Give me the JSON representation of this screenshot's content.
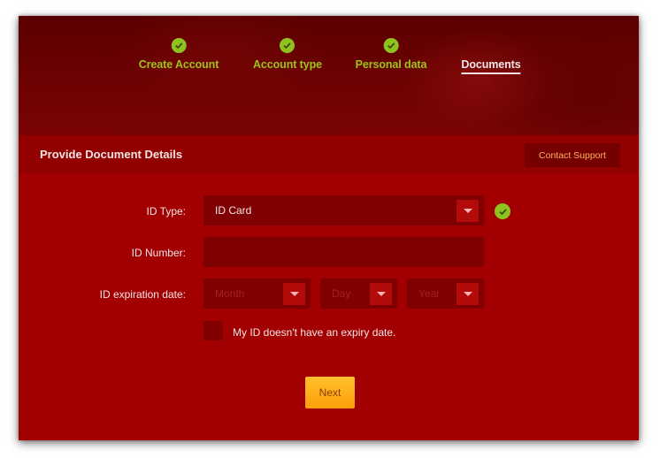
{
  "colors": {
    "accent_green": "#8dc21f",
    "primary_red": "#a20000",
    "button_orange": "#ffb01a",
    "contact_text": "#f6b75f"
  },
  "steps": [
    {
      "label": "Create Account",
      "status": "completed",
      "icon": "check-circle-icon"
    },
    {
      "label": "Account type",
      "status": "completed",
      "icon": "check-circle-icon"
    },
    {
      "label": "Personal data",
      "status": "completed",
      "icon": "check-circle-icon"
    },
    {
      "label": "Documents",
      "status": "active"
    }
  ],
  "section": {
    "title": "Provide Document Details",
    "contact_label": "Contact Support"
  },
  "form": {
    "id_type": {
      "label": "ID Type:",
      "value": "ID Card",
      "valid": true,
      "icon": "chevron-down-icon"
    },
    "id_number": {
      "label": "ID Number:",
      "value": "",
      "placeholder": ""
    },
    "expiration": {
      "label": "ID expiration date:",
      "month_placeholder": "Month",
      "day_placeholder": "Day",
      "year_placeholder": "Year"
    },
    "no_expiry": {
      "label": "My ID doesn't have an expiry date.",
      "checked": false
    }
  },
  "actions": {
    "next_label": "Next"
  }
}
